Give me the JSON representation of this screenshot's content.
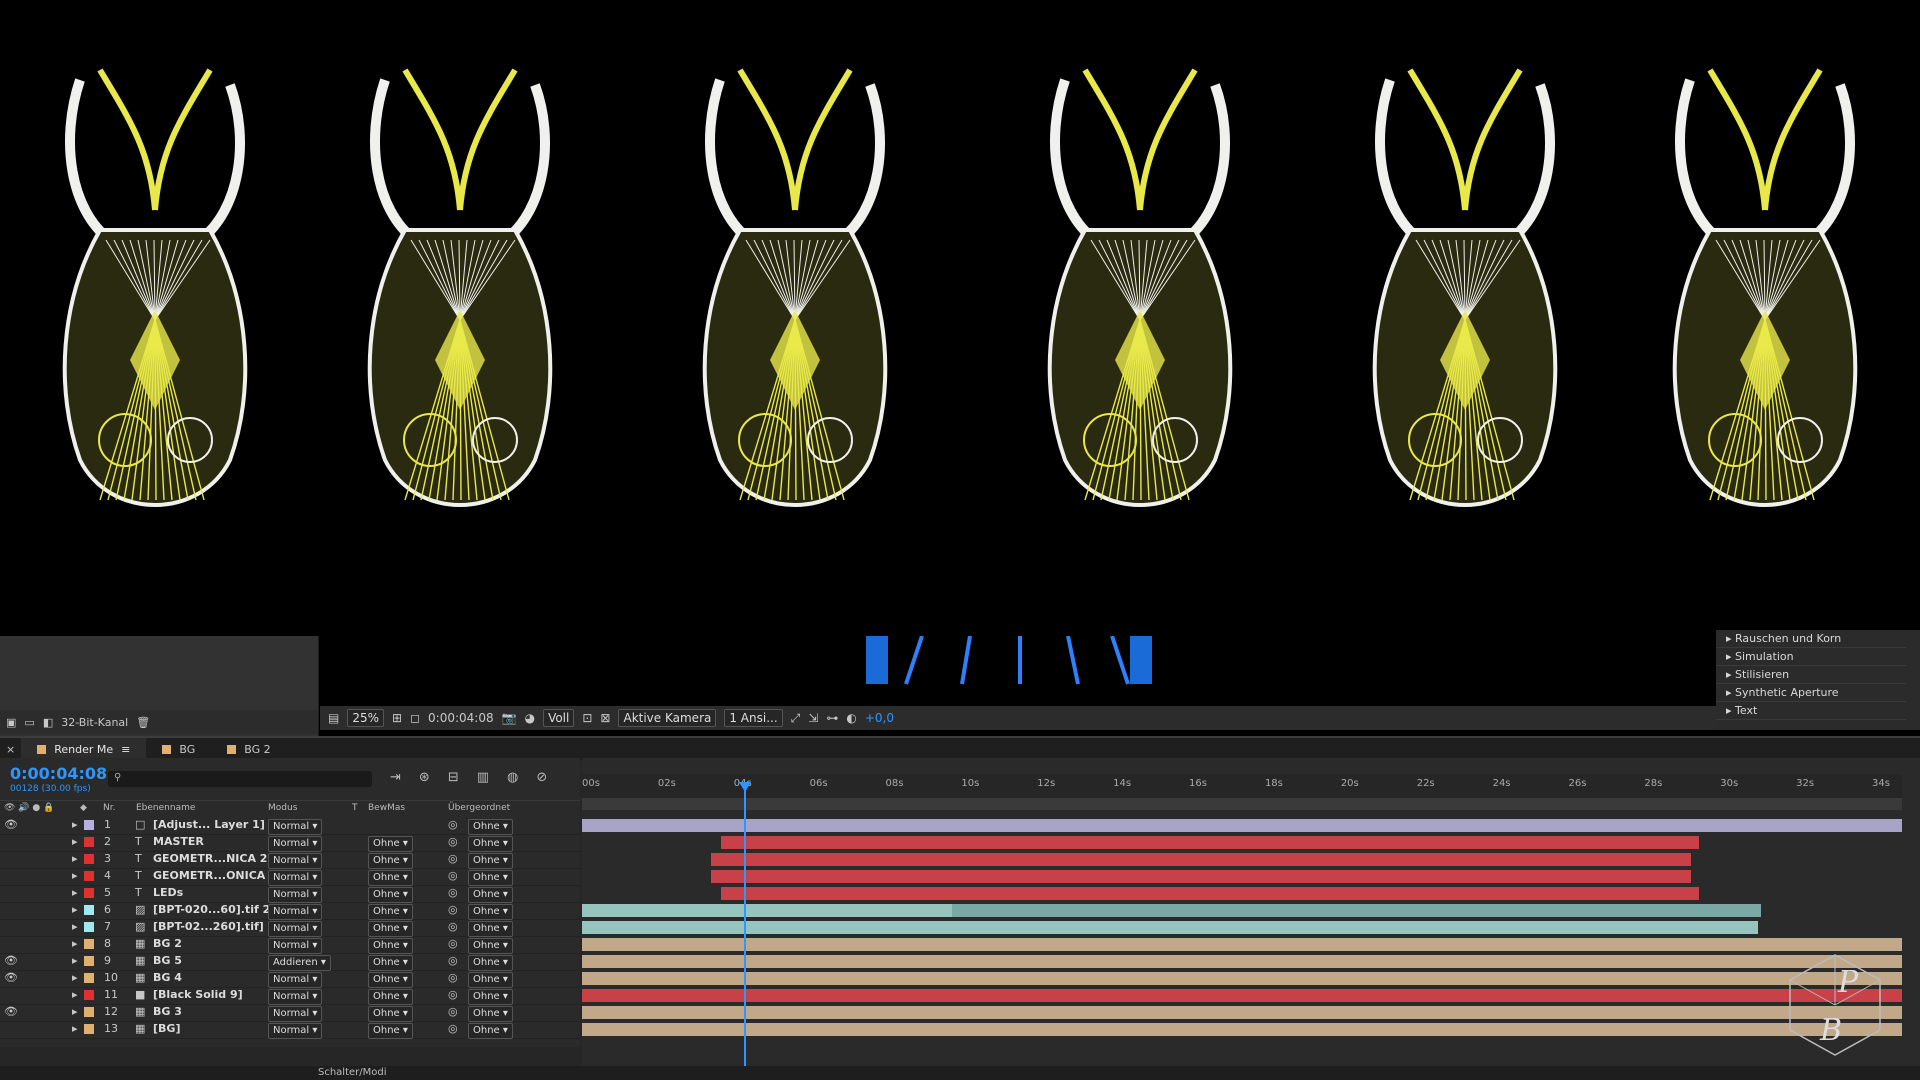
{
  "viewer": {
    "figures": [
      "pose-1",
      "pose-2",
      "pose-3",
      "pose-4",
      "pose-5",
      "pose-6"
    ]
  },
  "project": {
    "bitdepth": "32-Bit-Kanal"
  },
  "viewer_toolbar": {
    "zoom": "25%",
    "timecode": "0:00:04:08",
    "resolution": "Voll",
    "camera": "Aktive Kamera",
    "views": "1 Ansi...",
    "exposure": "+0,0"
  },
  "effects": {
    "items": [
      "Rauschen und Korn",
      "Simulation",
      "Stilisieren",
      "Synthetic Aperture",
      "Text"
    ]
  },
  "timeline": {
    "tabs": [
      {
        "label": "Render Me",
        "color": "#e0b070",
        "active": true
      },
      {
        "label": "BG",
        "color": "#e0b070",
        "active": false
      },
      {
        "label": "BG 2",
        "color": "#e0b070",
        "active": false
      }
    ],
    "current_time": "0:00:04:08",
    "frame_info": "00128 (30.00 fps)",
    "columns": {
      "nr": "Nr.",
      "name": "Ebenenname",
      "mode": "Modus",
      "t": "T",
      "trkmat": "BewMas",
      "parent": "Übergeordnet"
    },
    "ruler": [
      "00s",
      "02s",
      "04s",
      "06s",
      "08s",
      "10s",
      "12s",
      "14s",
      "16s",
      "18s",
      "20s",
      "22s",
      "24s",
      "26s",
      "28s",
      "30s",
      "32s",
      "34s"
    ],
    "layers": [
      {
        "nr": "1",
        "name": "[Adjust... Layer 1]",
        "type": "adj",
        "label": "#b8b0e0",
        "mode": "Normal",
        "trkmat": "",
        "parent": "Ohne",
        "eye": true,
        "bar_color": "#a8a4c8",
        "start": 0.0,
        "end": 1.0,
        "extra": null
      },
      {
        "nr": "2",
        "name": "MASTER",
        "type": "T",
        "label": "#e03030",
        "mode": "Normal",
        "trkmat": "Ohne",
        "parent": "Ohne",
        "eye": false,
        "bar_color": "#c84048",
        "start": 0.105,
        "end": 0.846,
        "extra": null
      },
      {
        "nr": "3",
        "name": "GEOMETR...NICA 2",
        "type": "T",
        "label": "#e03030",
        "mode": "Normal",
        "trkmat": "Ohne",
        "parent": "Ohne",
        "eye": false,
        "bar_color": "#c84048",
        "start": 0.098,
        "end": 0.84,
        "extra": null
      },
      {
        "nr": "4",
        "name": "GEOMETR...ONICA",
        "type": "T",
        "label": "#e03030",
        "mode": "Normal",
        "trkmat": "Ohne",
        "parent": "Ohne",
        "eye": false,
        "bar_color": "#c84048",
        "start": 0.098,
        "end": 0.84,
        "extra": null
      },
      {
        "nr": "5",
        "name": "LEDs",
        "type": "T",
        "label": "#e03030",
        "mode": "Normal",
        "trkmat": "Ohne",
        "parent": "Ohne",
        "eye": false,
        "bar_color": "#c84048",
        "start": 0.105,
        "end": 0.846,
        "extra": null
      },
      {
        "nr": "6",
        "name": "[BPT-020...60].tif 2",
        "type": "img",
        "label": "#a0e8f0",
        "mode": "Normal",
        "trkmat": "Ohne",
        "parent": "Ohne",
        "eye": false,
        "bar_color": "#98c4c0",
        "start": 0.0,
        "end": 0.893,
        "extra": "#7aa8a4"
      },
      {
        "nr": "7",
        "name": "[BPT-02...260].tif]",
        "type": "img",
        "label": "#a0e8f0",
        "mode": "Normal",
        "trkmat": "Ohne",
        "parent": "Ohne",
        "eye": false,
        "bar_color": "#98c4c0",
        "start": 0.0,
        "end": 0.891,
        "extra": null
      },
      {
        "nr": "8",
        "name": "BG 2",
        "type": "comp",
        "label": "#e0b070",
        "mode": "Normal",
        "trkmat": "Ohne",
        "parent": "Ohne",
        "eye": false,
        "bar_color": "#c0a888",
        "start": 0.0,
        "end": 1.0,
        "extra": null
      },
      {
        "nr": "9",
        "name": "BG 5",
        "type": "comp",
        "label": "#e0b070",
        "mode": "Addieren",
        "trkmat": "Ohne",
        "parent": "Ohne",
        "eye": true,
        "bar_color": "#c0a888",
        "start": 0.0,
        "end": 1.0,
        "extra": null
      },
      {
        "nr": "10",
        "name": "BG 4",
        "type": "comp",
        "label": "#e0b070",
        "mode": "Normal",
        "trkmat": "Ohne",
        "parent": "Ohne",
        "eye": true,
        "bar_color": "#c0a888",
        "start": 0.0,
        "end": 1.0,
        "extra": null
      },
      {
        "nr": "11",
        "name": "[Black Solid 9]",
        "type": "solid",
        "label": "#e03030",
        "mode": "Normal",
        "trkmat": "Ohne",
        "parent": "Ohne",
        "eye": false,
        "bar_color": "#c84048",
        "start": 0.0,
        "end": 1.0,
        "extra": null
      },
      {
        "nr": "12",
        "name": "BG 3",
        "type": "comp",
        "label": "#e0b070",
        "mode": "Normal",
        "trkmat": "Ohne",
        "parent": "Ohne",
        "eye": true,
        "bar_color": "#c0a888",
        "start": 0.0,
        "end": 1.0,
        "extra": null
      },
      {
        "nr": "13",
        "name": "[BG]",
        "type": "comp",
        "label": "#e0b070",
        "mode": "Normal",
        "trkmat": "Ohne",
        "parent": "Ohne",
        "eye": false,
        "bar_color": "#c0a888",
        "start": 0.0,
        "end": 1.0,
        "extra": null
      }
    ],
    "bottom_label": "Schalter/Modi"
  },
  "colors": {
    "accent": "#2f95ff",
    "figure_yellow": "#e8e84a",
    "figure_white": "#f0f0ec"
  },
  "watermark": {
    "letters": "PB"
  }
}
